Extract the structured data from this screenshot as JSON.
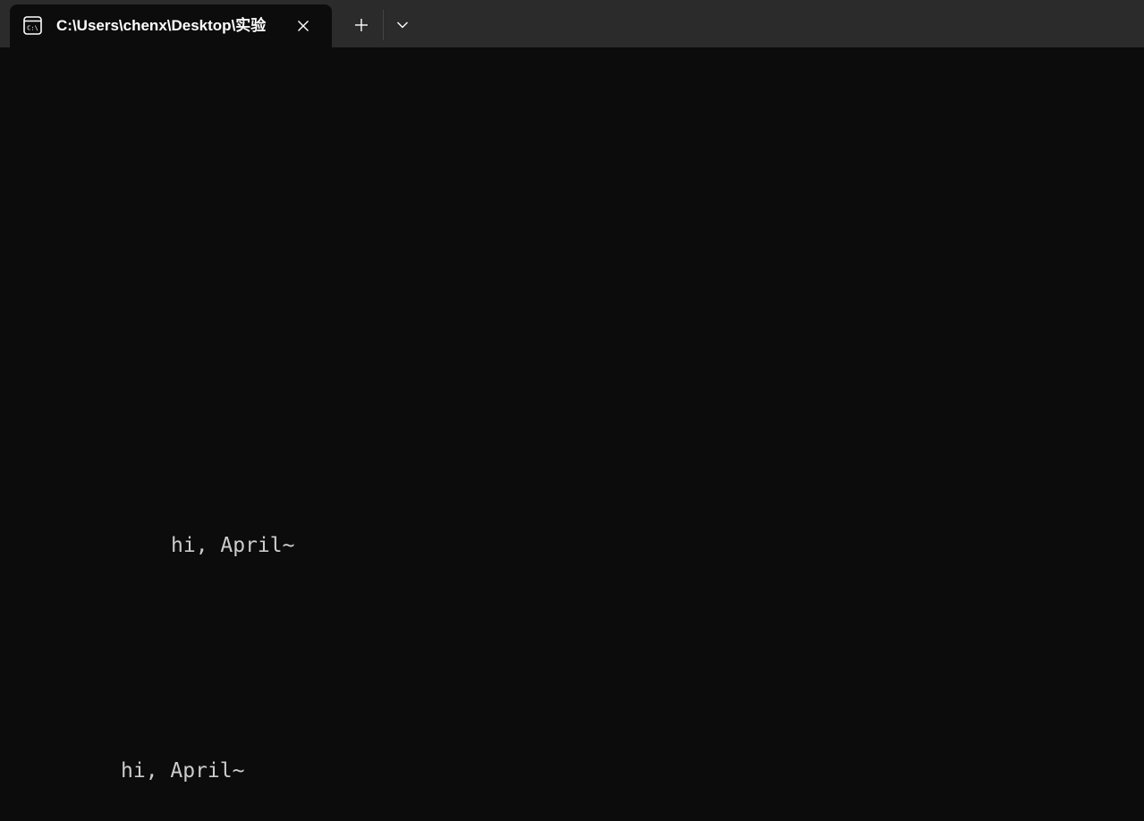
{
  "tab": {
    "title": "C:\\Users\\chenx\\Desktop\\实验",
    "icon": "cmd-prompt-icon"
  },
  "titlebar": {
    "new_tab_icon": "plus-icon",
    "dropdown_icon": "chevron-down-icon",
    "close_icon": "close-icon"
  },
  "terminal": {
    "lines": [
      "hi, April~",
      "hi, April~"
    ],
    "foreground": "#cccccc",
    "background": "#0c0c0c"
  }
}
